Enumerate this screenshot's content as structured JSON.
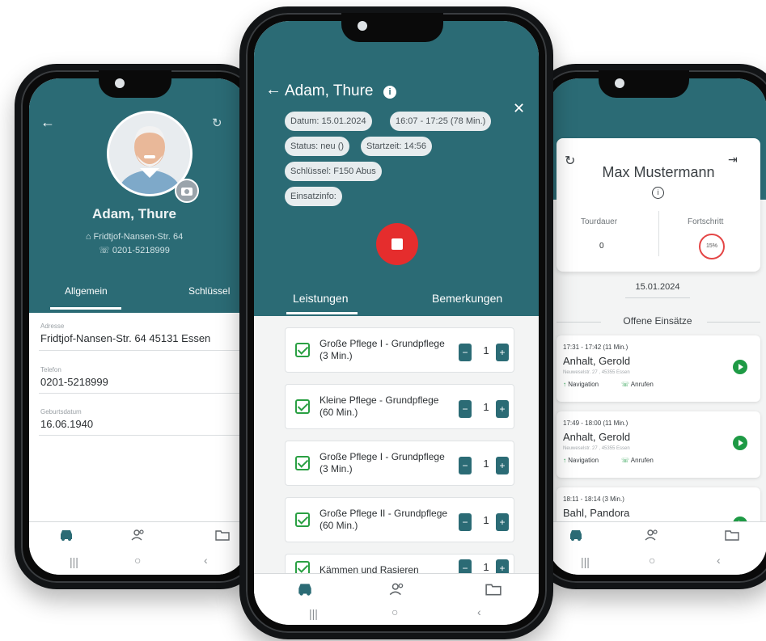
{
  "left_screen": {
    "patient_name": "Adam, Thure",
    "address": "Fridtjof-Nansen-Str. 64",
    "phone": "0201-5218999",
    "tabs": [
      "Allgemein",
      "Schlüssel"
    ],
    "fields": [
      {
        "label": "Adresse",
        "value": "Fridtjof-Nansen-Str. 64 45131 Essen"
      },
      {
        "label": "Telefon",
        "value": "0201-5218999"
      },
      {
        "label": "Geburtsdatum",
        "value": "16.06.1940"
      }
    ]
  },
  "mid_screen": {
    "title": "Adam, Thure",
    "pills": {
      "datum": "Datum: 15.01.2024",
      "zeit": "16:07 - 17:25 (78 Min.)",
      "status": "Status: neu ()",
      "startzeit": "Startzeit: 14:56",
      "schluessel": "Schlüssel: F150 Abus",
      "einsatzinfo": "Einsatzinfo:"
    },
    "tabs": [
      "Leistungen",
      "Bemerkungen"
    ],
    "services": [
      {
        "name": "Große Pflege I - Grundpflege (3 Min.)",
        "qty": "1"
      },
      {
        "name": "Kleine Pflege - Grundpflege (60 Min.)",
        "qty": "1"
      },
      {
        "name": "Große Pflege I - Grundpflege (3 Min.)",
        "qty": "1"
      },
      {
        "name": "Große Pflege II - Grundpflege (60 Min.)",
        "qty": "1"
      },
      {
        "name": "Kämmen und Rasieren",
        "qty": "1"
      }
    ],
    "stepper": {
      "minus": "−",
      "plus": "+"
    }
  },
  "right_screen": {
    "user_name": "Max Mustermann",
    "tourdauer_label": "Tourdauer",
    "tourdauer_value": "0",
    "fortschritt_label": "Fortschritt",
    "fortschritt_value": "15%",
    "date": "15.01.2024",
    "section_title": "Offene Einsätze",
    "jobs": [
      {
        "time": "17:31 - 17:42 (11 Min.)",
        "name": "Anhalt, Gerold",
        "address": "Neuweselstr. 27 , 45355 Essen",
        "nav": "Navigation",
        "call": "Anrufen"
      },
      {
        "time": "17:49 - 18:00 (11 Min.)",
        "name": "Anhalt, Gerold",
        "address": "Neuweselstr. 27 , 45355 Essen",
        "nav": "Navigation",
        "call": "Anrufen"
      },
      {
        "time": "18:11 - 18:14 (3 Min.)",
        "name": "Bahl, Pandora",
        "address": "",
        "nav": "",
        "call": ""
      }
    ]
  },
  "icons": {
    "back": "←",
    "close": "✕",
    "info": "i",
    "refresh": "↻",
    "logout": "⇥",
    "home": "⌂",
    "phone": "☏",
    "car": "🚗",
    "people": "👥",
    "folder": "▭",
    "sys_recent": "|||",
    "sys_home": "○",
    "sys_back": "‹",
    "navigation": "↑"
  },
  "colors": {
    "teal": "#2b6b75",
    "stop_red": "#e52d2d",
    "check_green": "#2aa043",
    "play_green": "#1e9a45"
  }
}
